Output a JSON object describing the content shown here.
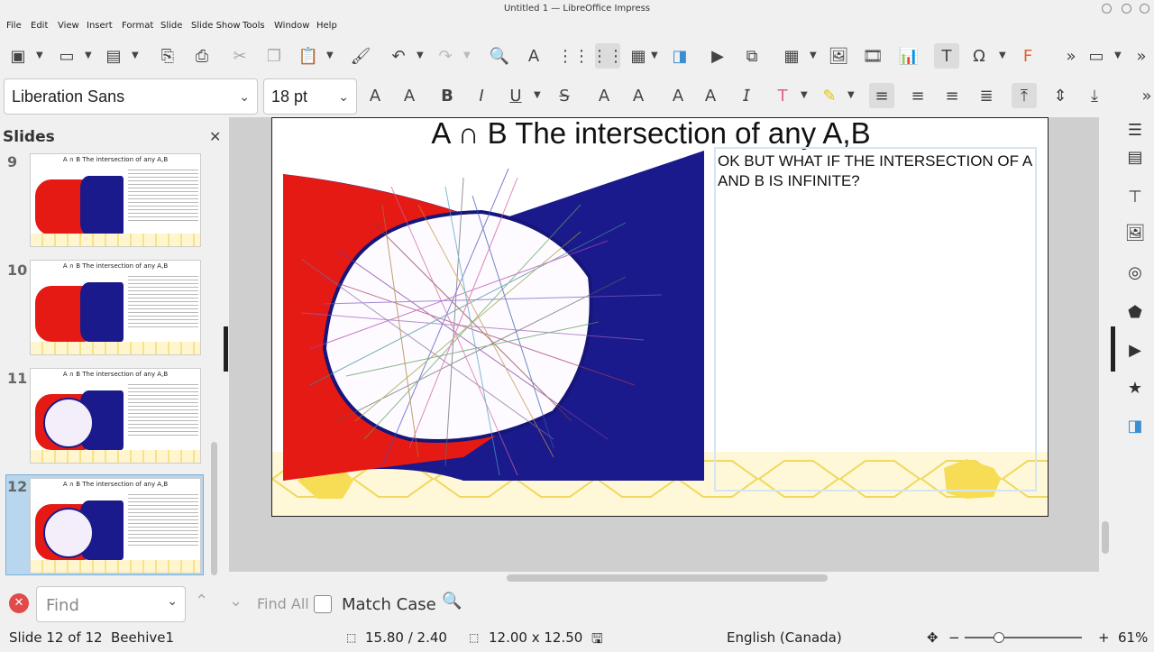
{
  "window": {
    "title": "Untitled 1 — LibreOffice Impress"
  },
  "menu": [
    "File",
    "Edit",
    "View",
    "Insert",
    "Format",
    "Slide",
    "Slide Show",
    "Tools",
    "Window",
    "Help"
  ],
  "formatting": {
    "font_name": "Liberation Sans",
    "font_size": "18 pt"
  },
  "slides_panel": {
    "title": "Slides",
    "close_icon": "close-icon",
    "thumbnails": [
      {
        "number": "9",
        "title": "A ∩ B  The intersection of any A,B"
      },
      {
        "number": "10",
        "title": "A ∩ B  The intersection of any A,B"
      },
      {
        "number": "11",
        "title": "A ∩ B  The intersection of any A,B"
      },
      {
        "number": "12",
        "title": "A ∩ B  The intersection of any A,B"
      }
    ]
  },
  "slide": {
    "title": "A ∩ B  The intersection of any A,B",
    "text": "OK BUT WHAT IF THE INTERSECTION OF A AND B IS INFINITE?"
  },
  "find": {
    "placeholder": "Find",
    "find_all": "Find All",
    "match_case": "Match Case"
  },
  "status": {
    "slide": "Slide 12 of 12",
    "master": "Beehive1",
    "position": "15.80 / 2.40",
    "size": "12.00 x 12.50",
    "language": "English (Canada)",
    "zoom": "61%"
  },
  "colors": {
    "red": "#e51a14",
    "navy": "#1a1a8c",
    "honeycomb": "#f7e28a",
    "selection": "#b8d7ee"
  }
}
